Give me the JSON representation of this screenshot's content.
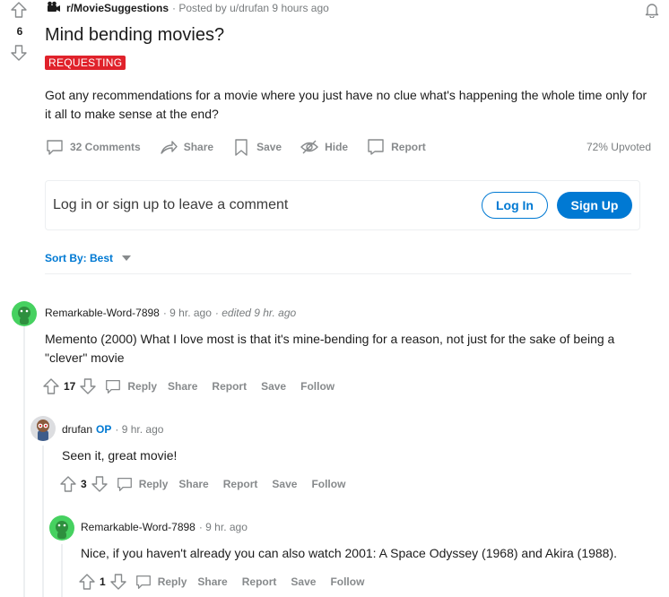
{
  "post": {
    "score": "6",
    "subreddit": "r/MovieSuggestions",
    "posted_by": "· Posted by u/drufan 9 hours ago",
    "title": "Mind bending movies?",
    "flair": "REQUESTING",
    "body": "Got any recommendations for a movie where you just have no clue what's happening the whole time only for it all to make sense at the end?",
    "actions": {
      "comments": "32 Comments",
      "share": "Share",
      "save": "Save",
      "hide": "Hide",
      "report": "Report"
    },
    "upvoted": "72% Upvoted"
  },
  "comment_box": {
    "prompt": "Log in or sign up to leave a comment",
    "login": "Log In",
    "signup": "Sign Up"
  },
  "sort": {
    "label": "Sort By: Best"
  },
  "comments": [
    {
      "author": "Remarkable-Word-7898",
      "time": "· 9 hr. ago",
      "edited": "· edited 9 hr. ago",
      "text": "Memento (2000) What I love most is that it's mine-bending for a reason, not just for the sake of being a \"clever\" movie",
      "score": "17",
      "reply": "Reply",
      "share": "Share",
      "report": "Report",
      "save": "Save",
      "follow": "Follow"
    },
    {
      "author": "drufan",
      "op": "OP",
      "time": "· 9 hr. ago",
      "text": "Seen it, great movie!",
      "score": "3",
      "reply": "Reply",
      "share": "Share",
      "report": "Report",
      "save": "Save",
      "follow": "Follow"
    },
    {
      "author": "Remarkable-Word-7898",
      "time": "· 9 hr. ago",
      "text": "Nice, if you haven't already you can also watch 2001: A Space Odyssey (1968) and Akira (1988).",
      "score": "1",
      "reply": "Reply",
      "share": "Share",
      "report": "Report",
      "save": "Save",
      "follow": "Follow"
    }
  ],
  "colors": {
    "accent": "#0079d3",
    "flair_bg": "#e0222b",
    "avatar_green": "#46d160",
    "icon_gray": "#878a8c"
  },
  "icons": [
    "upvote-icon",
    "downvote-icon",
    "subreddit-icon",
    "bell-icon",
    "comment-icon",
    "share-icon",
    "save-icon",
    "hide-icon",
    "report-icon",
    "caret-down-icon"
  ]
}
